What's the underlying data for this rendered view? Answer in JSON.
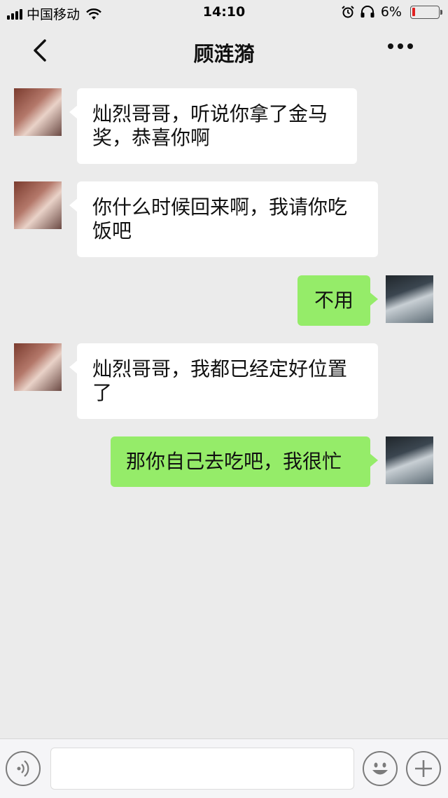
{
  "status_bar": {
    "carrier": "中国移动",
    "time": "14:10",
    "battery_percent": "6%",
    "battery_color": "#e02020"
  },
  "header": {
    "title": "顾涟漪",
    "back_icon": "chevron-left-icon",
    "more_icon": "more-dots-icon"
  },
  "messages": [
    {
      "side": "left",
      "text_line1": "灿烈哥哥，听说你拿了金马",
      "text_line2": "奖，恭喜你啊"
    },
    {
      "side": "left",
      "text_line1": "你什么时候回来啊，我请你吃",
      "text_line2": "饭吧"
    },
    {
      "side": "right",
      "text": "不用"
    },
    {
      "side": "left",
      "text_line1": "灿烈哥哥，我都已经定好位置",
      "text_line2": "了"
    },
    {
      "side": "right",
      "text": "那你自己去吃吧，我很忙"
    }
  ],
  "input_bar": {
    "voice_icon": "voice-icon",
    "emoji_icon": "emoji-icon",
    "plus_icon": "plus-icon",
    "input_value": ""
  },
  "colors": {
    "background": "#ebebeb",
    "bubble_left": "#ffffff",
    "bubble_right": "#95ec69"
  }
}
